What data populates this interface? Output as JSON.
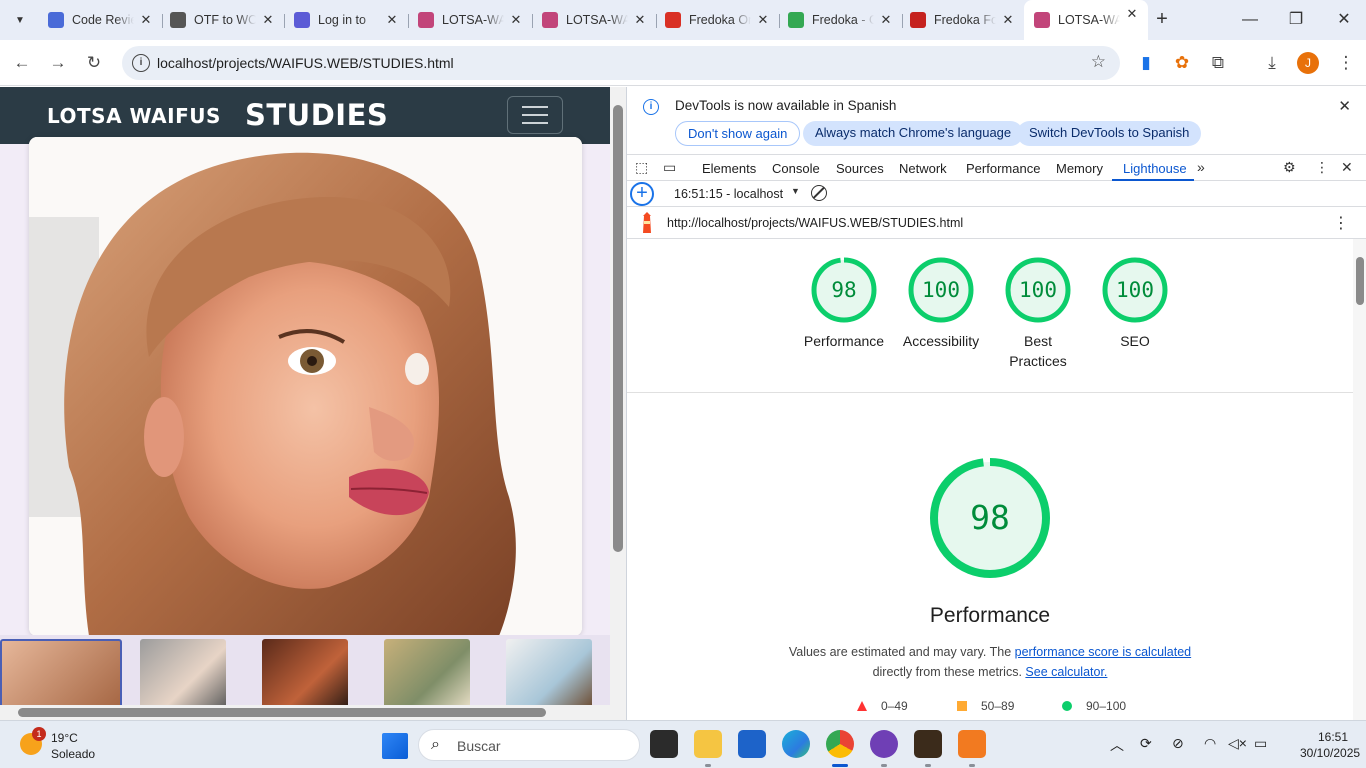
{
  "tabs": [
    {
      "title": "Code Review",
      "favicon": "code-review-icon",
      "color": "#4a6bd8"
    },
    {
      "title": "OTF to WOFF",
      "favicon": "cloud-convert-icon",
      "color": "#555555"
    },
    {
      "title": "Log in to",
      "favicon": "infinity-icon",
      "color": "#5b5bd6"
    },
    {
      "title": "LOTSA-WAIFUS",
      "favicon": "waifu-avatar-icon",
      "color": "#c2457a"
    },
    {
      "title": "LOTSA-WAIFUS",
      "favicon": "waifu-avatar-icon",
      "color": "#c2457a"
    },
    {
      "title": "Fredoka One",
      "favicon": "fontspring-icon",
      "color": "#d93025"
    },
    {
      "title": "Fredoka - Google",
      "favicon": "google-fonts-icon",
      "color": "#34a853"
    },
    {
      "title": "Fredoka Font",
      "favicon": "fredoka-f-icon",
      "color": "#c5221f"
    },
    {
      "title": "LOTSA-WAIFUS",
      "favicon": "waifu-avatar-icon",
      "color": "#c2457a",
      "active": true
    }
  ],
  "address": {
    "url": "localhost/projects/WAIFUS.WEB/STUDIES.html"
  },
  "profile": {
    "initial": "J"
  },
  "site": {
    "brand": "LOTSA WAIFUS",
    "title": "STUDIES"
  },
  "devtools": {
    "infobar": {
      "message": "DevTools is now available in Spanish",
      "btn_dont_show": "Don't show again",
      "btn_match": "Always match Chrome's language",
      "btn_switch": "Switch DevTools to Spanish"
    },
    "panels": [
      "Elements",
      "Console",
      "Sources",
      "Network",
      "Performance",
      "Memory",
      "Lighthouse"
    ],
    "active_panel": "Lighthouse",
    "report_select": "16:51:15 - localhost",
    "report_url": "http://localhost/projects/WAIFUS.WEB/STUDIES.html",
    "gauges": [
      {
        "score": "98",
        "label": "Performance",
        "fill": 0.98
      },
      {
        "score": "100",
        "label": "Accessibility",
        "fill": 1.0
      },
      {
        "score": "100",
        "label": "Best Practices",
        "fill": 1.0
      },
      {
        "score": "100",
        "label": "SEO",
        "fill": 1.0
      }
    ],
    "main_score": {
      "score": "98",
      "title": "Performance",
      "fill": 0.98
    },
    "desc_part1": "Values are estimated and may vary. The ",
    "desc_link1": "performance score is calculated",
    "desc_part2": " directly from these metrics. ",
    "desc_link2": "See calculator.",
    "legend": [
      {
        "range": "0–49",
        "shape": "triangle",
        "color": "#ff3333"
      },
      {
        "range": "50–89",
        "shape": "square",
        "color": "#ffaa33"
      },
      {
        "range": "90–100",
        "shape": "circle",
        "color": "#0cce6b"
      }
    ],
    "colors": {
      "pass": "#0cce6b",
      "pass_text": "#008c3a",
      "pass_bg": "#e6f8ee",
      "accent": "#0b57d0"
    }
  },
  "taskbar": {
    "weather": {
      "temp": "19°C",
      "condition": "Soleado",
      "badge": "1"
    },
    "search_placeholder": "Buscar",
    "time": "16:51",
    "date": "30/10/2025"
  }
}
